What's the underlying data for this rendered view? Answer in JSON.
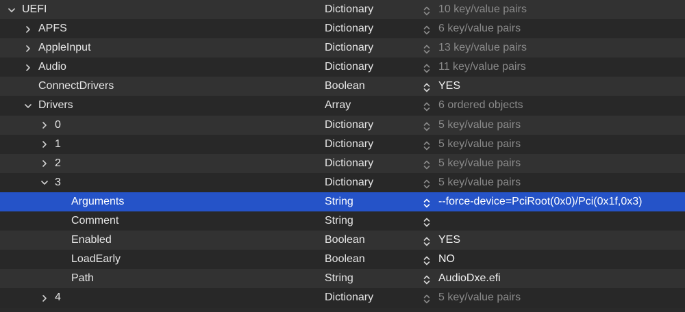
{
  "rows": [
    {
      "key": "UEFI",
      "depth": 0,
      "expander": "expanded",
      "type": "Dictionary",
      "value": "10 key/value pairs",
      "muted": true,
      "selected": false
    },
    {
      "key": "APFS",
      "depth": 1,
      "expander": "collapsed",
      "type": "Dictionary",
      "value": "6 key/value pairs",
      "muted": true,
      "selected": false
    },
    {
      "key": "AppleInput",
      "depth": 1,
      "expander": "collapsed",
      "type": "Dictionary",
      "value": "13 key/value pairs",
      "muted": true,
      "selected": false
    },
    {
      "key": "Audio",
      "depth": 1,
      "expander": "collapsed",
      "type": "Dictionary",
      "value": "11 key/value pairs",
      "muted": true,
      "selected": false
    },
    {
      "key": "ConnectDrivers",
      "depth": 1,
      "expander": "none",
      "type": "Boolean",
      "value": "YES",
      "muted": false,
      "selected": false
    },
    {
      "key": "Drivers",
      "depth": 1,
      "expander": "expanded",
      "type": "Array",
      "value": "6 ordered objects",
      "muted": true,
      "selected": false
    },
    {
      "key": "0",
      "depth": 2,
      "expander": "collapsed",
      "type": "Dictionary",
      "value": "5 key/value pairs",
      "muted": true,
      "selected": false
    },
    {
      "key": "1",
      "depth": 2,
      "expander": "collapsed",
      "type": "Dictionary",
      "value": "5 key/value pairs",
      "muted": true,
      "selected": false
    },
    {
      "key": "2",
      "depth": 2,
      "expander": "collapsed",
      "type": "Dictionary",
      "value": "5 key/value pairs",
      "muted": true,
      "selected": false
    },
    {
      "key": "3",
      "depth": 2,
      "expander": "expanded",
      "type": "Dictionary",
      "value": "5 key/value pairs",
      "muted": true,
      "selected": false
    },
    {
      "key": "Arguments",
      "depth": 3,
      "expander": "none",
      "type": "String",
      "value": "--force-device=PciRoot(0x0)/Pci(0x1f,0x3)",
      "muted": false,
      "selected": true
    },
    {
      "key": "Comment",
      "depth": 3,
      "expander": "none",
      "type": "String",
      "value": "",
      "muted": false,
      "selected": false
    },
    {
      "key": "Enabled",
      "depth": 3,
      "expander": "none",
      "type": "Boolean",
      "value": "YES",
      "muted": false,
      "selected": false
    },
    {
      "key": "LoadEarly",
      "depth": 3,
      "expander": "none",
      "type": "Boolean",
      "value": "NO",
      "muted": false,
      "selected": false
    },
    {
      "key": "Path",
      "depth": 3,
      "expander": "none",
      "type": "String",
      "value": "AudioDxe.efi",
      "muted": false,
      "selected": false
    },
    {
      "key": "4",
      "depth": 2,
      "expander": "collapsed",
      "type": "Dictionary",
      "value": "5 key/value pairs",
      "muted": true,
      "selected": false
    }
  ],
  "colors": {
    "selection": "#2553c8",
    "row_alt": "#323232",
    "row_base": "#282828",
    "muted_text": "#8a8a8a",
    "text": "#e6e6e6"
  },
  "icons": {
    "expanded": "chevron-down-icon",
    "collapsed": "chevron-right-icon",
    "stepper": "stepper-updown-icon"
  }
}
